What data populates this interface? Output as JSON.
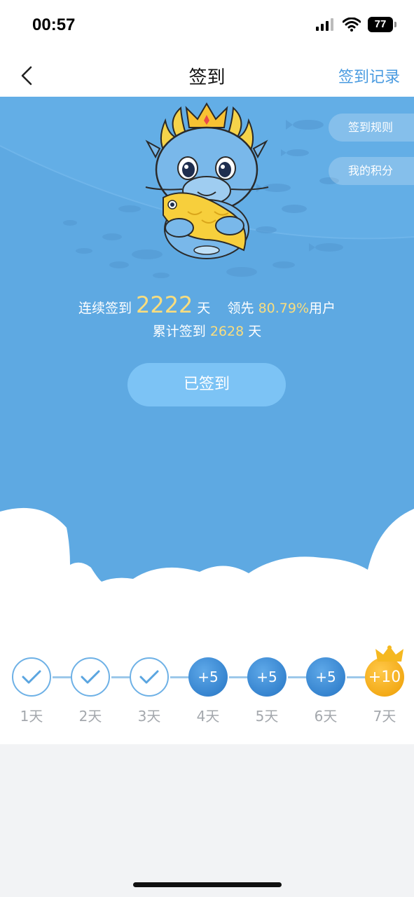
{
  "status_bar": {
    "time": "00:57",
    "battery": "77"
  },
  "nav": {
    "title": "签到",
    "right_link": "签到记录"
  },
  "side_buttons": {
    "rules": "签到规则",
    "points": "我的积分"
  },
  "stats": {
    "streak_prefix": "连续签到",
    "streak_days": "2222",
    "streak_unit": "天",
    "lead_prefix": "领先",
    "lead_pct": "80.79%",
    "lead_suffix": "用户",
    "total_prefix": "累计签到",
    "total_days": "2628",
    "total_unit": "天"
  },
  "checkin_button": "已签到",
  "days": [
    {
      "label": "1天",
      "state": "done",
      "reward": ""
    },
    {
      "label": "2天",
      "state": "done",
      "reward": ""
    },
    {
      "label": "3天",
      "state": "done",
      "reward": ""
    },
    {
      "label": "4天",
      "state": "pending",
      "reward": "+5"
    },
    {
      "label": "5天",
      "state": "pending",
      "reward": "+5"
    },
    {
      "label": "6天",
      "state": "pending",
      "reward": "+5"
    },
    {
      "label": "7天",
      "state": "bonus",
      "reward": "+10"
    }
  ],
  "colors": {
    "accent": "#4a9be0",
    "hero_bg": "#5ea9e2",
    "highlight": "#f9dd7e",
    "bonus": "#f2a814"
  }
}
